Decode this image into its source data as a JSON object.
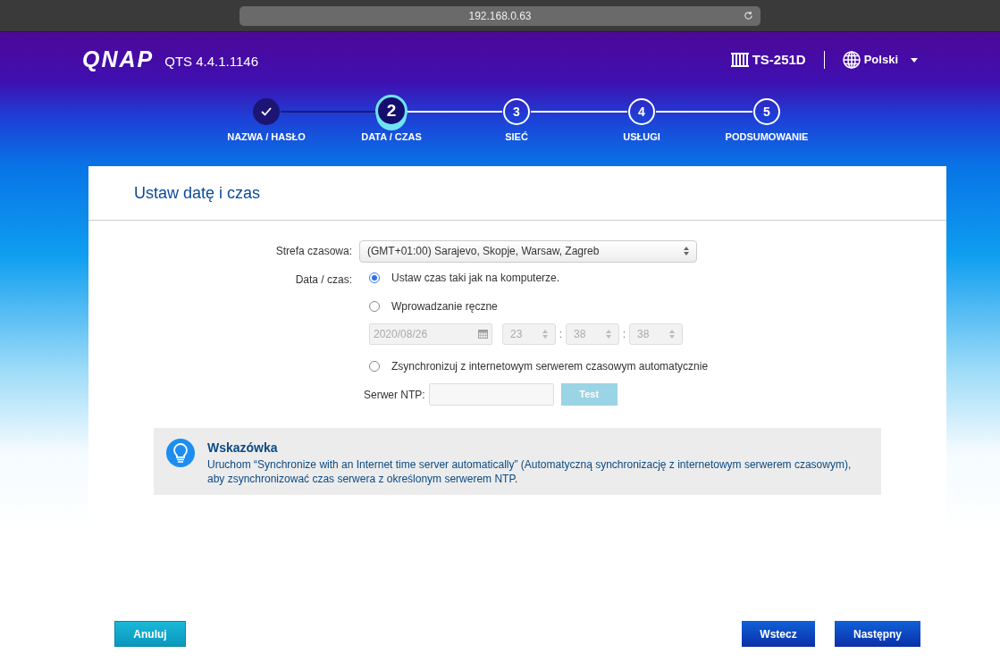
{
  "browser": {
    "url": "192.168.0.63"
  },
  "header": {
    "logo": "QNAP",
    "version": "QTS 4.4.1.1146",
    "device": "TS-251D",
    "language": "Polski"
  },
  "steps": [
    {
      "kind": "done",
      "label": "NAZWA / HASŁO",
      "selected": false
    },
    {
      "kind": "current",
      "number": "2",
      "label": "DATA / CZAS",
      "selected": true
    },
    {
      "kind": "todo",
      "number": "3",
      "label": "SIEĆ",
      "selected": false
    },
    {
      "kind": "todo",
      "number": "4",
      "label": "USŁUGI",
      "selected": false
    },
    {
      "kind": "todo",
      "number": "5",
      "label": "PODSUMOWANIE",
      "selected": false
    }
  ],
  "panel": {
    "title": "Ustaw datę i czas"
  },
  "form": {
    "timezone_label": "Strefa czasowa:",
    "timezone_value": "(GMT+01:00) Sarajevo, Skopje, Warsaw, Zagreb",
    "date_time_label": "Data / czas:",
    "options": [
      {
        "label": "Ustaw czas taki jak na komputerze.",
        "selected": true
      },
      {
        "label": "Wprowadzanie ręczne",
        "selected": false
      },
      {
        "label": "Zsynchronizuj z internetowym serwerem czasowym automatycznie",
        "selected": false
      }
    ],
    "manual": {
      "disabled": true,
      "date": "2020/08/26",
      "hour": "23",
      "minute": "38",
      "second": "38",
      "separators": [
        ":",
        ":"
      ]
    },
    "ntp_label": "Serwer NTP:",
    "test_button": {
      "label": "Test",
      "disabled": true
    }
  },
  "hint": {
    "title": "Wskazówka",
    "text": "Uruchom “Synchronize with an Internet time server automatically” (Automatyczną synchronizację z internetowym serwerem czasowym), aby zsynchronizować czas serwera z określonym serwerem NTP."
  },
  "buttons": {
    "cancel": "Anuluj",
    "back": "Wstecz",
    "next": "Następny"
  }
}
